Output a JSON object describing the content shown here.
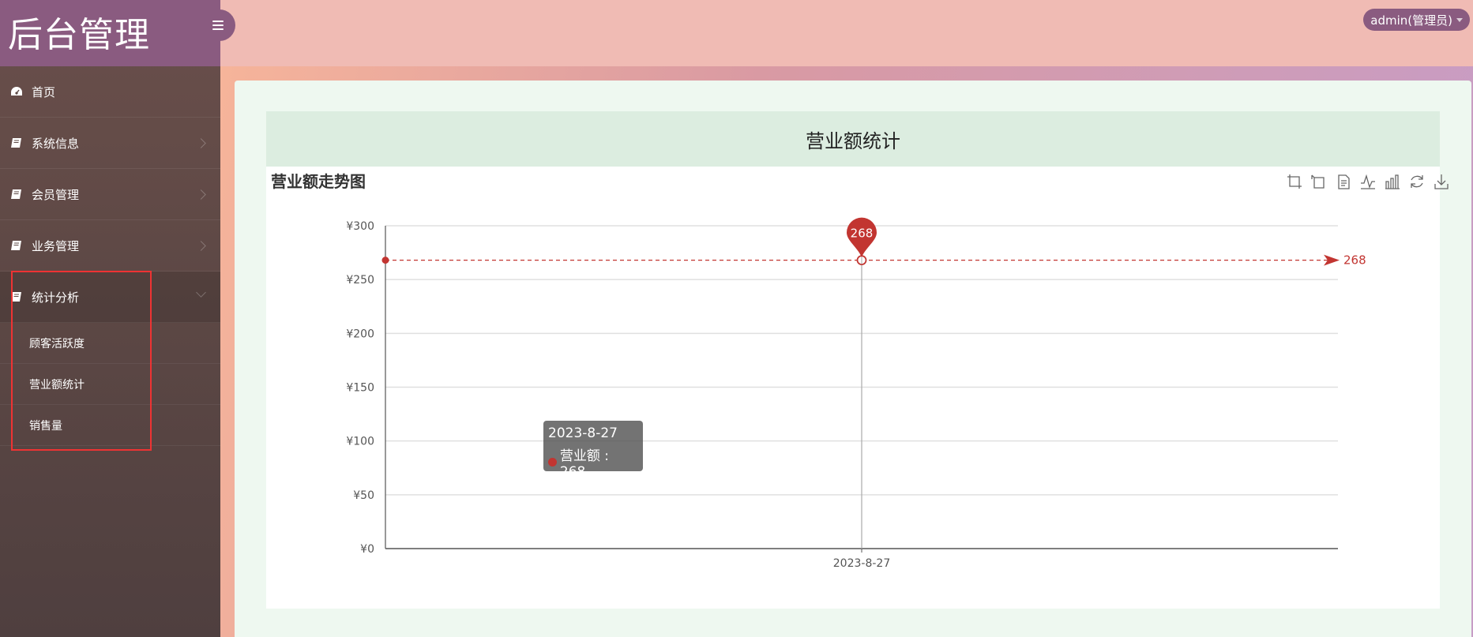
{
  "app": {
    "title": "后台管理"
  },
  "header": {
    "user_label": "admin(管理员)"
  },
  "sidebar": {
    "items": [
      {
        "label": "首页",
        "icon": "dashboard-icon"
      },
      {
        "label": "系统信息",
        "icon": "book-icon"
      },
      {
        "label": "会员管理",
        "icon": "book-icon"
      },
      {
        "label": "业务管理",
        "icon": "book-icon"
      },
      {
        "label": "统计分析",
        "icon": "book-icon"
      }
    ],
    "subitems": [
      {
        "label": "顾客活跃度"
      },
      {
        "label": "营业额统计"
      },
      {
        "label": "销售量"
      }
    ]
  },
  "page": {
    "card_title": "营业额统计"
  },
  "tooltip": {
    "date": "2023-8-27",
    "series_label": "营业额 : 268"
  },
  "colors": {
    "series": "#c23531",
    "sidebar_accent": "#8a5b80"
  },
  "chart_data": {
    "type": "line",
    "title": "营业额走势图",
    "categories": [
      "2023-8-27"
    ],
    "series": [
      {
        "name": "营业额",
        "values": [
          268
        ]
      }
    ],
    "ylim": [
      0,
      300
    ],
    "yticks": [
      "¥0",
      "¥50",
      "¥100",
      "¥150",
      "¥200",
      "¥250",
      "¥300"
    ],
    "ytick_values": [
      0,
      50,
      100,
      150,
      200,
      250,
      300
    ],
    "markpoint": {
      "label": "268",
      "value": 268
    },
    "markline": {
      "label": "268",
      "value": 268
    },
    "grid": true,
    "toolbox": [
      "zoom-icon",
      "zoom-reset-icon",
      "data-view-icon",
      "line-chart-icon",
      "bar-chart-icon",
      "restore-icon",
      "save-image-icon"
    ]
  }
}
